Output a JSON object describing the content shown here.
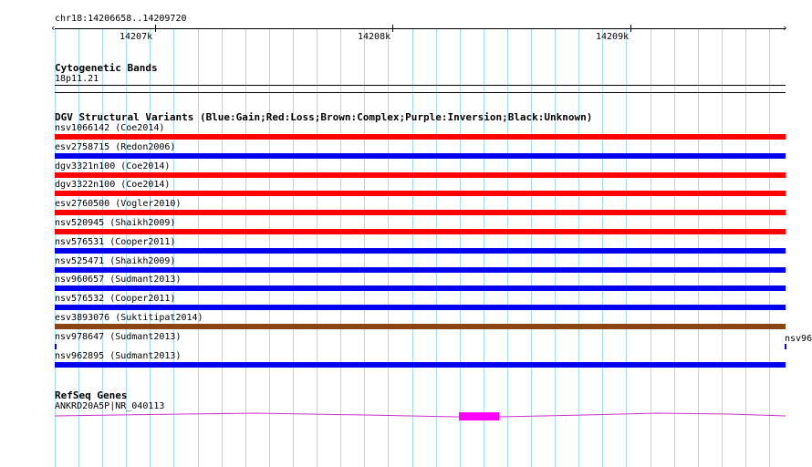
{
  "region": {
    "label": "chr18:14206658..14209720",
    "ticks": [
      "14207k",
      "14208k",
      "14209k"
    ]
  },
  "cytoband": {
    "title": "Cytogenetic Bands",
    "band_label": "18p11.21"
  },
  "dgv": {
    "title": "DGV Structural Variants (Blue:Gain;Red:Loss;Brown:Complex;Purple:Inversion;Black:Unknown)",
    "colors": {
      "gain": "#0000ee",
      "loss": "#ff0000",
      "complex": "#8b4513",
      "inversion": "#800080",
      "unknown": "#000000"
    },
    "items": [
      {
        "label": "nsv1066142 (Coe2014)",
        "type": "loss"
      },
      {
        "label": "esv2758715 (Redon2006)",
        "type": "gain"
      },
      {
        "label": "dgv3321n100 (Coe2014)",
        "type": "loss"
      },
      {
        "label": "dgv3322n100 (Coe2014)",
        "type": "loss"
      },
      {
        "label": "esv2760500 (Vogler2010)",
        "type": "loss"
      },
      {
        "label": "nsv520945 (Shaikh2009)",
        "type": "loss"
      },
      {
        "label": "nsv576531 (Cooper2011)",
        "type": "gain"
      },
      {
        "label": "nsv525471 (Shaikh2009)",
        "type": "gain"
      },
      {
        "label": "nsv960657 (Sudmant2013)",
        "type": "gain"
      },
      {
        "label": "nsv576532 (Cooper2011)",
        "type": "gain"
      },
      {
        "label": "esv3893076 (Suktitipat2014)",
        "type": "complex"
      },
      {
        "label": "nsv978647 (Sudmant2013)",
        "type": "gain"
      },
      {
        "label": "nsv962895 (Sudmant2013)",
        "type": "gain"
      }
    ],
    "edge_label": "nsv96"
  },
  "refseq": {
    "title": "RefSeq Genes",
    "gene_label": "ANKRD20A5P|NR_040113"
  }
}
